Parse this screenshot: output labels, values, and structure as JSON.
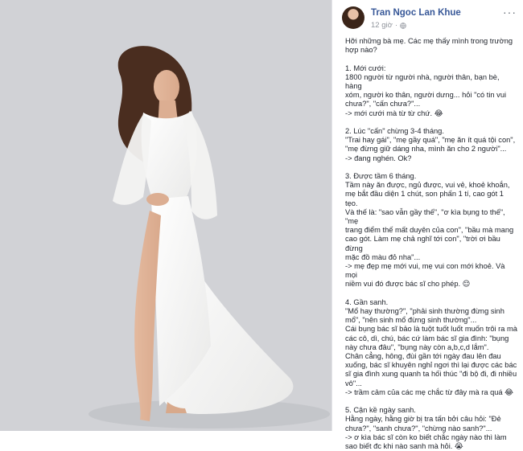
{
  "post": {
    "author": "Tran Ngoc Lan Khue",
    "time": "12 giờ",
    "privacy_icon": "globe-icon",
    "more_icon": "more-dots-icon",
    "lines": [
      "Hỡi những bà mẹ. Các mẹ thấy mình trong trường",
      "hợp nào?",
      "",
      "1. Mới cưới:",
      "1800 người từ người nhà, người thân, bạn bè, hàng",
      "xóm, người ko thân, người dưng... hỏi \"có tin vui",
      "chưa?\", \"cấn chưa?\"...",
      "-> mới cưới mà từ từ chứ. 😂",
      "",
      "2. Lúc \"cấn\" chừng 3-4 tháng.",
      "\"Trai hay gái\", \"mẹ gầy quá\", \"mẹ ăn ít quá tội con\",",
      "\"mẹ đừng giữ dáng nha, mình ăn cho 2 người\"...",
      "-> đang nghén. Ok?",
      "",
      "3. Được tầm 6 tháng.",
      "Tầm này ăn được, ngủ được, vui vẻ, khoẻ khoắn,",
      "mẹ bắt đầu diện 1 chút, son phấn 1 tí, cao gót 1 tẹo.",
      "Và thế là: \"sao vẫn gầy thế\", \"ơ kìa bụng to thế\", \"mẹ",
      "trang điểm thế mất duyên của con\", \"bầu mà mang",
      "cao gót. Làm mẹ chả nghĩ tới con\", \"trời ơi bầu đừng",
      "mặc đồ màu đỏ nha\"...",
      "-> mẹ đẹp mẹ mới vui, mẹ vui con mới khoẻ. Và mọi",
      "niềm vui đó được bác sĩ cho phép. 😌",
      "",
      "4. Gần sanh.",
      "\"Mổ hay thường?\", \"phải sinh thường đừng sinh",
      "mổ\", \"nên sinh mổ đừng sinh thường\"...",
      "Cái bụng bác sĩ bảo là tuột tuốt luốt muốn trôi ra mà",
      "các cô, dì, chú, bác cứ làm bác sĩ gia đình: \"bụng",
      "này chưa đâu\", \"bụng này còn a,b,c,d lắm\".",
      "Chân cẳng, hông, đùi gần tới ngày đau lên đau",
      "xuống, bác sĩ khuyên nghỉ ngơi thì lại được các bác",
      "sĩ gia đình xung quanh ta hối thúc \"đi bộ đi, đi nhiều",
      "vô\"...",
      "-> trầm cảm của các mẹ chắc từ đây mà ra quá 😂",
      "",
      "5. Cận kề ngày sanh.",
      "Hằng ngày, hằng giờ bị tra tấn bởi câu hỏi: \"Đẻ",
      "chưa?\", \"sanh chưa?\", \"chừng nào sanh?\"...",
      "-> ơ kìa bác sĩ còn ko biết chắc ngày nào thì làm",
      "sao biết đc khi nào sanh mà hỏi. 😭"
    ]
  },
  "photo": {
    "subject": "photo-woman-white-dress",
    "background_color": "#d1d2d6",
    "dress_color": "#f6f6f4"
  },
  "colors": {
    "author": "#385898",
    "meta": "#90949c",
    "text": "#1d2129"
  }
}
